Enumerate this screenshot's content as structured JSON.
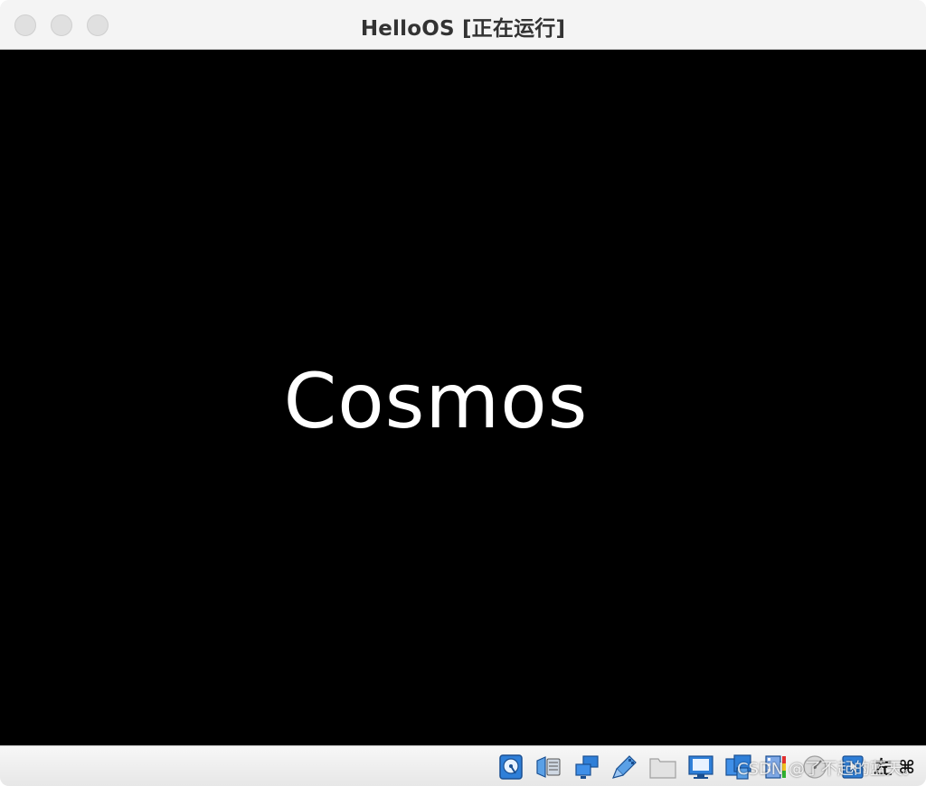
{
  "window": {
    "title": "HelloOS [正在运行]"
  },
  "screen": {
    "display_text": "Cosmos"
  },
  "statusbar": {
    "icons": [
      "hard-disk-icon",
      "optical-drive-icon",
      "network-icon",
      "usb-icon",
      "shared-folders-icon",
      "display-icon",
      "video-capture-icon",
      "recording-icon",
      "cpu-activity-icon",
      "mouse-integration-icon",
      "keyboard-icon"
    ],
    "host_key_label": "左 ⌘",
    "watermark": "CSDN @了不起的蓝天。"
  },
  "colors": {
    "screen_background": "#000000",
    "screen_text": "#ffffff",
    "titlebar": "#f4f4f4",
    "accent_blue": "#1f6fd1"
  }
}
